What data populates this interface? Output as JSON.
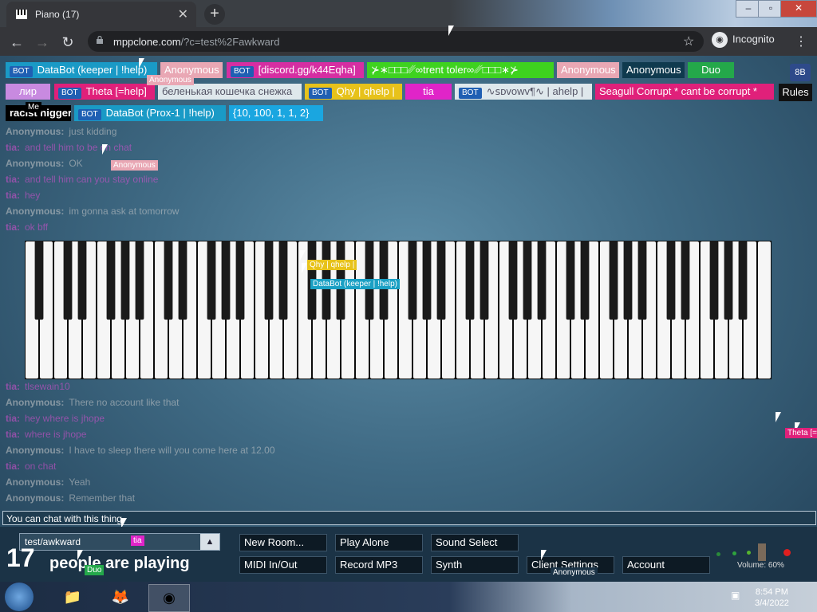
{
  "browser": {
    "tab_title": "Piano (17)",
    "url_host": "mppclone.com",
    "url_path": "/?c=test%2Fawkward",
    "incognito_label": "Incognito"
  },
  "users_row1": [
    "DataBot (keeper | !help)",
    "Anonymous",
    "[discord.gg/k44Eqha]",
    "⊁∗□□□␥∞trent toler∞␥□□□∗⊁",
    "Anonymous",
    "Anonymous",
    "Duo"
  ],
  "users_row2": [
    "лир",
    "Theta [=help]",
    "беленькая кошечка снежка",
    "Qhy | qhelp |",
    "tia",
    "∿ꜱᴅᴠᴏᴡᴠ¶∿ | ahelp |",
    "Seagull Corrupt * cant be corrupt *"
  ],
  "users_row3": [
    "racist nigger",
    "DataBot (Prox-1 | !help)",
    "{10, 100, 1, 1, 2}"
  ],
  "bot_tag": "BOT",
  "me_label": "Me",
  "btn_8b": "8B",
  "btn_rules": "Rules",
  "chat_messages": [
    {
      "name": "Anonymous:",
      "text": "just kidding",
      "color": "#cccccc"
    },
    {
      "name": "tia:",
      "text": "and tell him to be on chat",
      "color": "#e24fd8"
    },
    {
      "name": "Anonymous:",
      "text": "OK",
      "color": "#cccccc"
    },
    {
      "name": "tia:",
      "text": "and tell him can you stay online",
      "color": "#e24fd8"
    },
    {
      "name": "tia:",
      "text": "hey",
      "color": "#e24fd8"
    },
    {
      "name": "Anonymous:",
      "text": "im gonna ask at tomorrow",
      "color": "#cccccc"
    },
    {
      "name": "tia:",
      "text": "ok bff",
      "color": "#e24fd8"
    },
    {
      "name": "tia:",
      "text": "tlsewain10",
      "color": "#e24fd8"
    },
    {
      "name": "Anonymous:",
      "text": "There no account like that",
      "color": "#cccccc"
    },
    {
      "name": "tia:",
      "text": "hey where is jhope",
      "color": "#e24fd8"
    },
    {
      "name": "tia:",
      "text": "where is jhope",
      "color": "#e24fd8"
    },
    {
      "name": "Anonymous:",
      "text": "I have to sleep there will you come here at 12.00",
      "color": "#cccccc"
    },
    {
      "name": "tia:",
      "text": "on chat",
      "color": "#e24fd8"
    },
    {
      "name": "Anonymous:",
      "text": "Yeah",
      "color": "#cccccc"
    },
    {
      "name": "Anonymous:",
      "text": "Remember that",
      "color": "#cccccc"
    }
  ],
  "chat_input_placeholder": "You can chat with this thing.",
  "room_name": "test/awkward",
  "player_count": "17",
  "player_count_label": "people are playing",
  "buttons_row1": [
    "New Room...",
    "Play Alone",
    "Sound Select"
  ],
  "buttons_row2": [
    "MIDI In/Out",
    "Record MP3",
    "Synth",
    "Client Settings",
    "Account"
  ],
  "volume_label": "Volume: 60%",
  "cursors": [
    {
      "label": "Anonymous"
    },
    {
      "label": "Anonymous"
    },
    {
      "label": "Qhy | qhelp |"
    },
    {
      "label": "DataBot (keeper | !help)"
    },
    {
      "label": "Theta [=help]"
    },
    {
      "label": "tia"
    },
    {
      "label": "Duo"
    },
    {
      "label": "Anonymous"
    }
  ],
  "clock": {
    "time": "8:54 PM",
    "date": "3/4/2022"
  },
  "colors": {
    "tia": "#e24fd8",
    "anonymous": "#cccccc",
    "qhy": "#e7c21a",
    "databot": "#1aa0c4",
    "theta": "#e0207a"
  },
  "icons": [
    "piano-icon",
    "close-icon",
    "plus-icon",
    "back-arrow-icon",
    "forward-arrow-icon",
    "reload-icon",
    "lock-icon",
    "star-icon",
    "incognito-icon",
    "kebab-menu-icon",
    "chevron-up-icon",
    "windows-start-icon",
    "folder-icon",
    "firefox-icon",
    "chrome-icon"
  ]
}
